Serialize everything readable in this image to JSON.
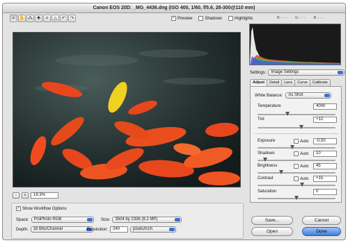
{
  "window": {
    "title": "Canon EOS 20D:  _MG_4436.dng  (ISO 400, 1/60, f/5.6, 28-300@110 mm)"
  },
  "toolbar": {
    "tools": [
      {
        "name": "zoom-tool",
        "glyph": "⌕"
      },
      {
        "name": "hand-tool",
        "glyph": "✋"
      },
      {
        "name": "white-balance-tool",
        "glyph": "⁂"
      },
      {
        "name": "color-sampler-tool",
        "glyph": "✚"
      },
      {
        "name": "crop-tool",
        "glyph": "⌗"
      },
      {
        "name": "straighten-tool",
        "glyph": "△"
      },
      {
        "name": "rotate-left-tool",
        "glyph": "↶"
      },
      {
        "name": "rotate-right-tool",
        "glyph": "↷"
      }
    ]
  },
  "preview_options": {
    "preview": {
      "label": "Preview",
      "checked": true
    },
    "shadows": {
      "label": "Shadows",
      "checked": false
    },
    "highlights": {
      "label": "Highlights",
      "checked": false
    }
  },
  "histogram": {
    "readouts": {
      "r": "R: - - -",
      "g": "G: - - -",
      "b": "B: - - -"
    },
    "colors": {
      "red": "#e03a2a",
      "green": "#48b84a",
      "blue": "#3b5be0",
      "white": "#e8e8e8"
    }
  },
  "zoom": {
    "minus": "-",
    "plus": "+",
    "value": "19.3%"
  },
  "workflow": {
    "show_label": "Show Workflow Options",
    "show_checked": true,
    "space_label": "Space:",
    "space_value": "ProPhoto RGB",
    "size_label": "Size:",
    "size_value": "3504 by 2336  (8.2 MP)",
    "depth_label": "Depth:",
    "depth_value": "16 Bits/Channel",
    "resolution_label": "Resolution:",
    "resolution_value": "240",
    "resolution_unit": "pixels/inch"
  },
  "settings": {
    "label": "Settings:",
    "value": "Image Settings"
  },
  "tabs": [
    {
      "label": "Adjust",
      "active": true
    },
    {
      "label": "Detail",
      "active": false
    },
    {
      "label": "Lens",
      "active": false
    },
    {
      "label": "Curve",
      "active": false
    },
    {
      "label": "Calibrate",
      "active": false
    }
  ],
  "adjust": {
    "white_balance_label": "White Balance:",
    "white_balance_value": "As Shot",
    "temperature": {
      "label": "Temperature",
      "value": "4000",
      "position": 0.38
    },
    "tint": {
      "label": "Tint",
      "value": "+12",
      "position": 0.56
    },
    "exposure": {
      "label": "Exposure",
      "auto_label": "Auto",
      "auto_checked": false,
      "value": "-0.50",
      "position": 0.45
    },
    "shadows": {
      "label": "Shadows",
      "auto_label": "Auto",
      "auto_checked": false,
      "value": "10",
      "position": 0.1
    },
    "brightness": {
      "label": "Brightness",
      "auto_label": "Auto",
      "auto_checked": false,
      "value": "45",
      "position": 0.3
    },
    "contrast": {
      "label": "Contrast",
      "auto_label": "Auto",
      "auto_checked": false,
      "value": "+15",
      "position": 0.57
    },
    "saturation": {
      "label": "Saturation",
      "value": "0",
      "position": 0.5
    }
  },
  "buttons": {
    "save": "Save...",
    "cancel": "Cancel",
    "open": "Open",
    "done": "Done"
  }
}
